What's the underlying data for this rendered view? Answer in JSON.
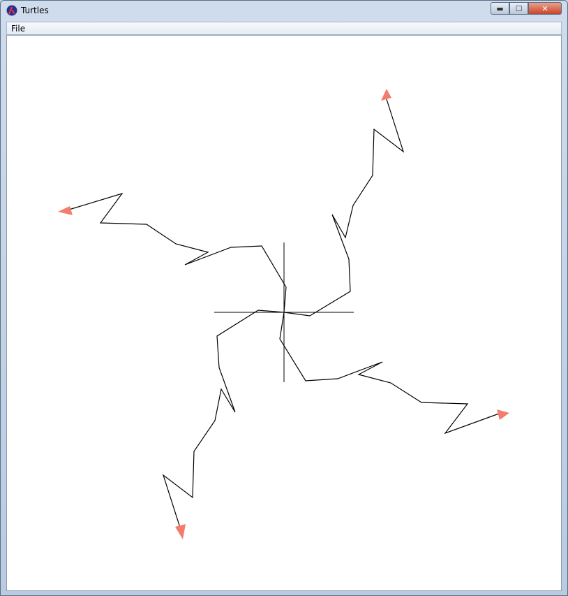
{
  "window": {
    "title": "Turtles"
  },
  "titlebar_buttons": {
    "minimize": "▬",
    "maximize": "☐",
    "close": "✕"
  },
  "menu": {
    "items": [
      {
        "label": "File"
      }
    ]
  },
  "colors": {
    "turtle": "#f47c6c",
    "pen": "#000000",
    "canvas": "#ffffff",
    "app_icon_bg": "#2a2f8f",
    "app_icon_fg": "#e23a3a"
  },
  "icons": {
    "app": "lambda-icon"
  }
}
